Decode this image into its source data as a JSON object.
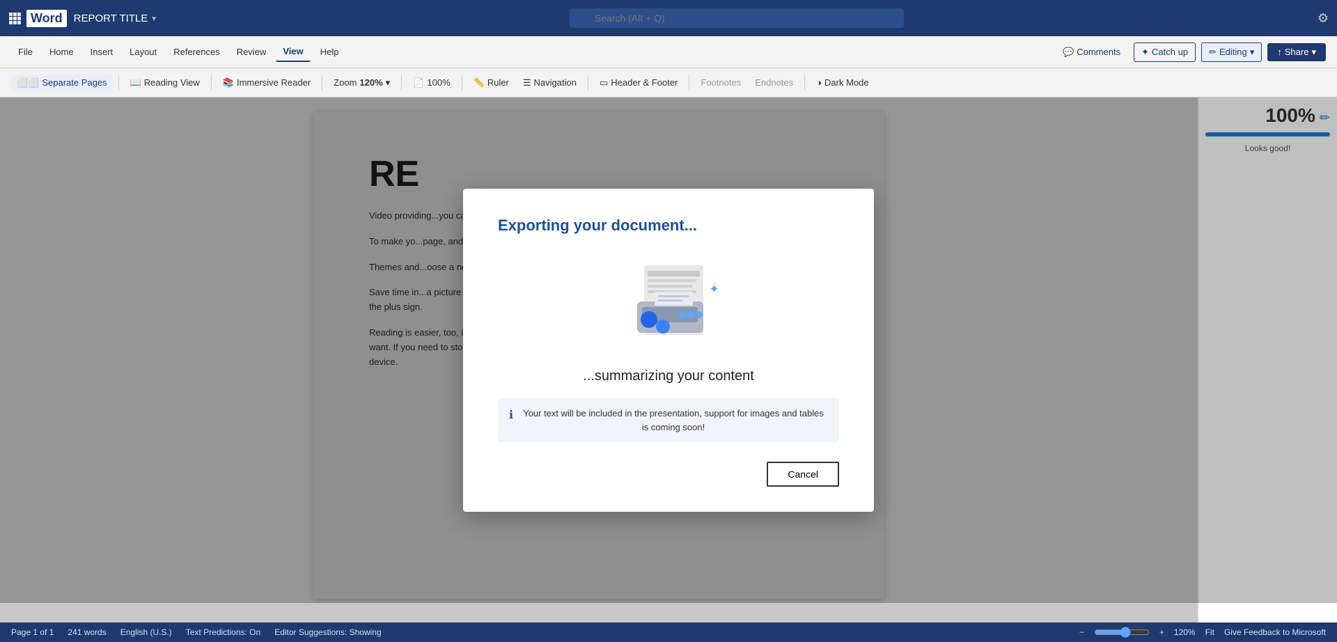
{
  "titlebar": {
    "app_name": "Word",
    "doc_title": "REPORT TITLE",
    "search_placeholder": "Search (Alt + Q)",
    "settings_icon": "settings-icon"
  },
  "ribbon": {
    "tabs": [
      {
        "id": "file",
        "label": "File"
      },
      {
        "id": "home",
        "label": "Home"
      },
      {
        "id": "insert",
        "label": "Insert"
      },
      {
        "id": "layout",
        "label": "Layout"
      },
      {
        "id": "references",
        "label": "References"
      },
      {
        "id": "review",
        "label": "Review"
      },
      {
        "id": "view",
        "label": "View"
      },
      {
        "id": "help",
        "label": "Help"
      }
    ],
    "active_tab": "view",
    "buttons": {
      "comments": "Comments",
      "catchup": "Catch up",
      "editing": "Editing",
      "share": "Share"
    }
  },
  "toolbar": {
    "items": [
      {
        "id": "separate-pages",
        "label": "Separate Pages",
        "active": true
      },
      {
        "id": "reading-view",
        "label": "Reading View"
      },
      {
        "id": "immersive-reader",
        "label": "Immersive Reader"
      },
      {
        "id": "zoom-label",
        "label": "Zoom"
      },
      {
        "id": "zoom-value",
        "label": "120%"
      },
      {
        "id": "fit-page",
        "label": "100%"
      },
      {
        "id": "ruler",
        "label": "Ruler"
      },
      {
        "id": "navigation",
        "label": "Navigation"
      },
      {
        "id": "header-footer",
        "label": "Header & Footer"
      },
      {
        "id": "footnotes",
        "label": "Footnotes"
      },
      {
        "id": "endnotes",
        "label": "Endnotes"
      },
      {
        "id": "dark-mode",
        "label": "Dark Mode"
      }
    ]
  },
  "document": {
    "title": "RE",
    "paragraphs": [
      "Video provi...                                                      ou can paste in the...                                                   h online for the video t...",
      "To make yo...                                                      page, and text box des...                                              ge, header, and sidebar...",
      "Themes and...                                                      oose a new Theme, the...                                               you apply styles, your...",
      "Save time in...                                                    a picture fits in your c...                                            ork on a table, click where you want to add a row or a column, and then click the plus sign.",
      "Reading is easier, too, in the new Reading view. You can collapse parts of the document and focus on the text you want. If you need to stop reading before you reach the end, Word remembers where you left off - even on another device."
    ]
  },
  "right_panel": {
    "progress_pct": "100%",
    "progress_fill": 100,
    "status": "Looks good!"
  },
  "status_bar": {
    "page_info": "Page 1 of 1",
    "word_count": "241 words",
    "language": "English (U.S.)",
    "text_predictions": "Text Predictions: On",
    "editor_suggestions": "Editor Suggestions: Showing",
    "zoom_out_icon": "zoom-out-icon",
    "zoom_in_icon": "zoom-in-icon",
    "zoom_level": "120%",
    "fit": "Fit",
    "feedback": "Give Feedback to Microsoft"
  },
  "dialog": {
    "title": "Exporting your document...",
    "subtitle": "...summarizing your content",
    "info_text": "Your text will be included in the presentation, support for images and tables is coming soon!",
    "cancel_label": "Cancel"
  }
}
